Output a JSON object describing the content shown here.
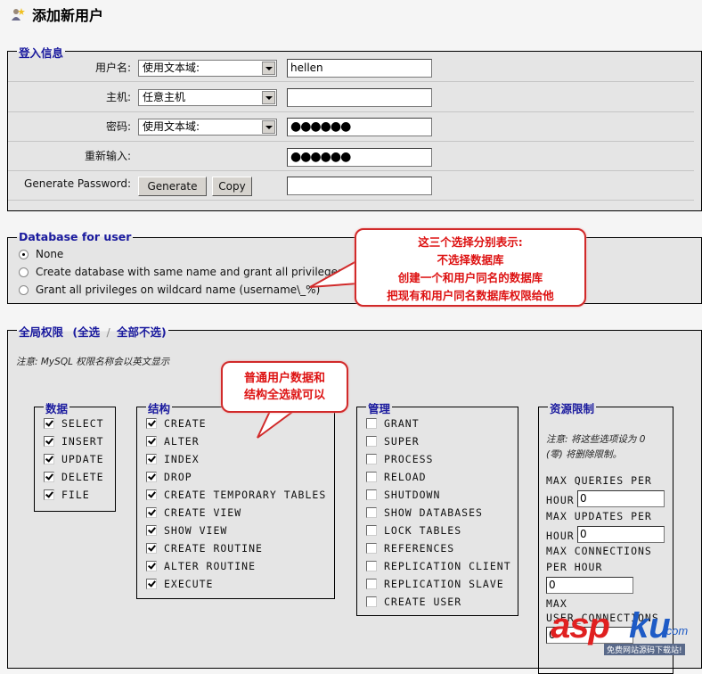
{
  "page": {
    "title": "添加新用户",
    "title_icon": "add-user-icon"
  },
  "login": {
    "legend": "登入信息",
    "username": {
      "label": "用户名:",
      "select": "使用文本域:",
      "value": "hellen"
    },
    "host": {
      "label": "主机:",
      "select": "任意主机",
      "value": ""
    },
    "password": {
      "label": "密码:",
      "select": "使用文本域:",
      "value": "●●●●●●"
    },
    "retype": {
      "label": "重新输入:",
      "value": "●●●●●●"
    },
    "generate": {
      "label": "Generate Password:",
      "generate_button": "Generate",
      "copy_button": "Copy",
      "value": ""
    }
  },
  "database": {
    "legend": "Database for user",
    "options": [
      {
        "label": "None",
        "selected": true
      },
      {
        "label": "Create database with same name and grant all privileges",
        "selected": false
      },
      {
        "label": "Grant all privileges on wildcard name (username\\_%)",
        "selected": false
      }
    ]
  },
  "callout_db": {
    "lines": [
      "这三个选择分别表示:",
      "不选择数据库",
      "创建一个和用户同名的数据库",
      "把现有和用户同名数据库权限给他"
    ]
  },
  "global": {
    "legend": "全局权限",
    "check_all": "(全选",
    "separator": "/",
    "uncheck_all": "全部不选)",
    "note": "注意: MySQL 权限名称会以英文显示"
  },
  "callout_priv": {
    "lines": [
      "普通用户数据和",
      "结构全选就可以"
    ]
  },
  "groups": {
    "data": {
      "legend": "数据",
      "items": [
        {
          "label": "SELECT",
          "checked": true
        },
        {
          "label": "INSERT",
          "checked": true
        },
        {
          "label": "UPDATE",
          "checked": true
        },
        {
          "label": "DELETE",
          "checked": true
        },
        {
          "label": "FILE",
          "checked": true
        }
      ]
    },
    "structure": {
      "legend": "结构",
      "items": [
        {
          "label": "CREATE",
          "checked": true
        },
        {
          "label": "ALTER",
          "checked": true
        },
        {
          "label": "INDEX",
          "checked": true
        },
        {
          "label": "DROP",
          "checked": true
        },
        {
          "label": "CREATE TEMPORARY TABLES",
          "checked": true
        },
        {
          "label": "CREATE VIEW",
          "checked": true
        },
        {
          "label": "SHOW VIEW",
          "checked": true
        },
        {
          "label": "CREATE ROUTINE",
          "checked": true
        },
        {
          "label": "ALTER ROUTINE",
          "checked": true
        },
        {
          "label": "EXECUTE",
          "checked": true
        }
      ]
    },
    "admin": {
      "legend": "管理",
      "items": [
        {
          "label": "GRANT",
          "checked": false
        },
        {
          "label": "SUPER",
          "checked": false
        },
        {
          "label": "PROCESS",
          "checked": false
        },
        {
          "label": "RELOAD",
          "checked": false
        },
        {
          "label": "SHUTDOWN",
          "checked": false
        },
        {
          "label": "SHOW DATABASES",
          "checked": false
        },
        {
          "label": "LOCK TABLES",
          "checked": false
        },
        {
          "label": "REFERENCES",
          "checked": false
        },
        {
          "label": "REPLICATION CLIENT",
          "checked": false
        },
        {
          "label": "REPLICATION SLAVE",
          "checked": false
        },
        {
          "label": "CREATE USER",
          "checked": false
        }
      ]
    },
    "resources": {
      "legend": "资源限制",
      "note_line1": "注意: 将这些选项设为 0",
      "note_line2": "(零) 将删除限制。",
      "max_queries_1": "MAX QUERIES PER",
      "max_queries_2": "HOUR",
      "max_queries_value": "0",
      "max_updates_1": "MAX UPDATES PER",
      "max_updates_2": "HOUR",
      "max_updates_value": "0",
      "max_connections_1": "MAX CONNECTIONS",
      "max_connections_2": "PER HOUR",
      "max_connections_value": "0",
      "max_user_conn_1": "MAX",
      "max_user_conn_2": "USER_CONNECTIONS",
      "max_user_conn_value": "0"
    }
  },
  "watermark": {
    "part1": "asp",
    "part2": "ku",
    "part3": ".com",
    "sub": "免费网站源码下载站!"
  }
}
